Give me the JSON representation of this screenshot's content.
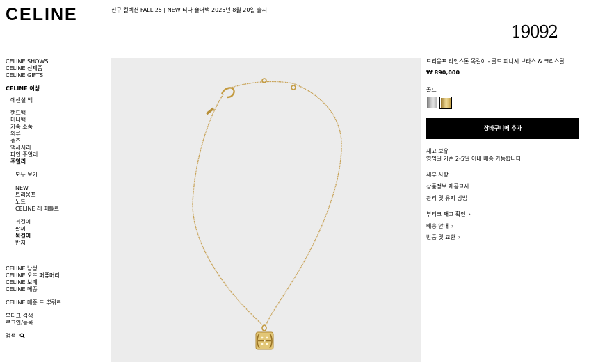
{
  "header": {
    "logo": "CELINE",
    "announce_prefix": "신규 컬렉션",
    "announce_fall": "FALL 25",
    "announce_sep": "| NEW",
    "announce_tina": "티나 숄더백",
    "announce_date": "2025년 8월 20일 출시",
    "brand_mark": "19092"
  },
  "nav": {
    "shows": "CELINE SHOWS",
    "new_items": "CELINE 신제품",
    "gifts": "CELINE GIFTS",
    "women": "CELINE 여성",
    "essential_bags": "에센셜 백",
    "handbags": "핸드백",
    "mini_bags": "미니백",
    "leather_goods": "가죽 소품",
    "clothing": "의류",
    "shoes": "슈즈",
    "accessories": "액세서리",
    "fine_jewelry": "파인 주얼리",
    "jewelry": "주얼리",
    "view_all": "모두 보기",
    "new": "NEW",
    "triomphe": "트리옹프",
    "node": "노드",
    "celine_letter": "CELINE 레 페틀르",
    "earrings": "귀걸이",
    "bracelets": "팔찌",
    "necklaces": "목걸이",
    "rings": "반지",
    "men": "CELINE 남성",
    "perfume": "CELINE 오뜨 퍼퓨머리",
    "beauty": "CELINE 보떼",
    "maison": "CELINE 메종",
    "maison_de_parfum": "CELINE 메종 드 뿌뤼르",
    "boutique_search": "부티크 검색",
    "login": "로그인/등록",
    "search": "검색"
  },
  "product": {
    "title": "트리옹프 라인스톤 목걸이 - 골드 피니시 브라스 & 크리스탈",
    "price": "₩ 890,000",
    "color_label": "골드",
    "cart_button": "장바구니에 추가",
    "stock": "재고 보유",
    "delivery": "영업일 기준 2-5일 이내 배송 가능합니다.",
    "details": "세부 사항",
    "product_info": "상품정보 제공고시",
    "care": "관리 및 유지 방법",
    "boutique_stock": "부티크 재고 확인",
    "shipping": "배송 안내",
    "returns": "반품 및 교환",
    "chevron": "›"
  },
  "colors": {
    "gallery_bg": "#ececec",
    "chain": "#c9a45a",
    "cart_bg": "#000000"
  },
  "icons": [
    "search-icon",
    "chevron-right-icon",
    "celine-triomphe-pendant"
  ]
}
